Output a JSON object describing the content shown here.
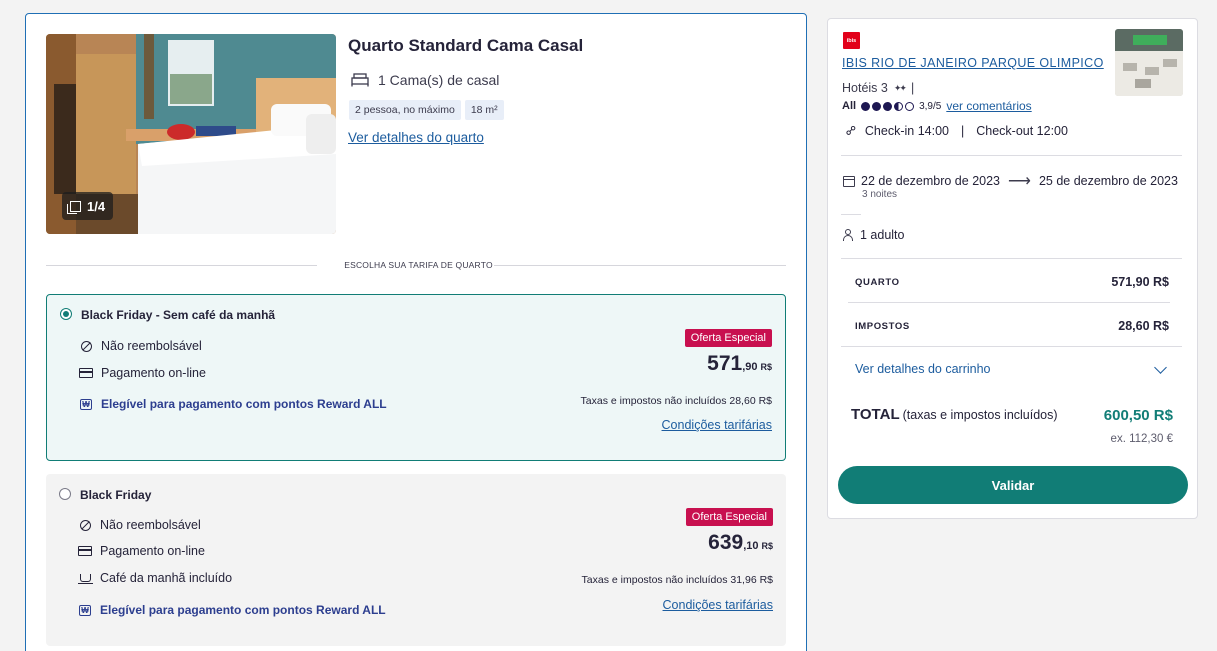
{
  "room": {
    "title": "Quarto Standard Cama Casal",
    "bed": "1 Cama(s) de casal",
    "tags": [
      "2 pessoa, no máximo",
      "18 m²"
    ],
    "details_link": "Ver detalhes do quarto",
    "image_counter": "1/4"
  },
  "rate_divider": "ESCOLHA SUA TARIFA DE QUARTO",
  "rates": [
    {
      "name": "Black Friday - Sem café da manhã",
      "selected": true,
      "features": [
        "Não reembolsável",
        "Pagamento on-line"
      ],
      "reward": "Elegível para pagamento com pontos Reward ALL",
      "badge": "Oferta Especial",
      "price_main": "571",
      "price_cents": ",90",
      "currency": "R$",
      "taxes": "Taxas e impostos não incluídos 28,60 R$",
      "conditions": "Condições tarifárias"
    },
    {
      "name": "Black Friday",
      "selected": false,
      "features": [
        "Não reembolsável",
        "Pagamento on-line",
        "Café da manhã incluído"
      ],
      "reward": "Elegível para pagamento com pontos Reward ALL",
      "badge": "Oferta Especial",
      "price_main": "639",
      "price_cents": ",10",
      "currency": "R$",
      "taxes": "Taxas e impostos não incluídos 31,96 R$",
      "conditions": "Condições tarifárias"
    }
  ],
  "summary": {
    "brand_logo": "ibis",
    "hotel_name": "IBIS RIO DE JANEIRO PARQUE OLIMPICO",
    "category": "Hotéis 3",
    "rating_brand": "All",
    "rating_value": 3.9,
    "rating_text": "3,9/5",
    "reviews_link": "ver comentários",
    "check_in": "Check-in 14:00",
    "check_out": "Check-out 12:00",
    "date_from": "22 de dezembro de 2023",
    "date_to": "25 de dezembro de 2023",
    "nights": "3 noites",
    "guests": "1 adulto",
    "room_label": "QUARTO",
    "room_value": "571,90 R$",
    "taxes_label": "IMPOSTOS",
    "taxes_value": "28,60 R$",
    "cart_details": "Ver detalhes do carrinho",
    "total_label": "TOTAL",
    "total_note": "(taxas e impostos incluídos)",
    "total_value": "600,50 R$",
    "ex_value": "ex. 112,30 €",
    "validate_button": "Validar"
  },
  "colors": {
    "accent_teal": "#117d76",
    "link_blue": "#1c5c9e",
    "badge_pink": "#c8104f",
    "reward_navy": "#2c3e8f",
    "ibis_red": "#e2001a"
  },
  "icons": {
    "bed": "bed-icon",
    "no_refund": "ban-icon",
    "payment": "credit-card-icon",
    "breakfast": "coffee-cup-icon",
    "reward": "reward-icon",
    "checkin": "link-icon",
    "calendar": "calendar-icon",
    "guests": "person-icon",
    "chevron": "chevron-down-icon"
  }
}
